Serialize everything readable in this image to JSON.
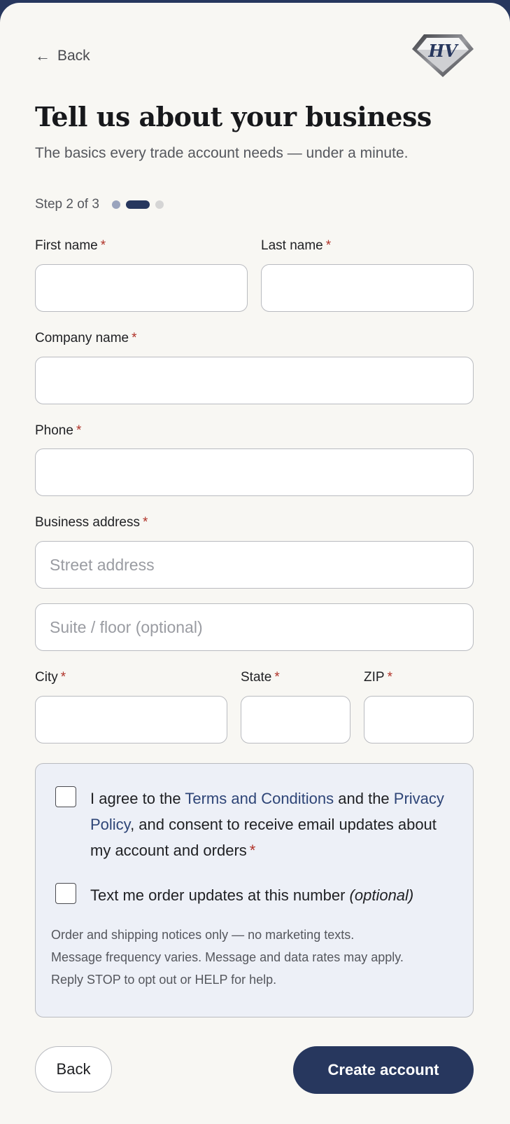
{
  "header": {
    "back_label": "Back",
    "back_arrow": "←",
    "logo_icon": "diamond-monogram-logo",
    "logo_text": "HV"
  },
  "page": {
    "title": "Tell us about your business",
    "subtitle": "The basics every trade account needs — under a minute.",
    "step_label": "Step 2 of 3",
    "step_current": 2,
    "step_total": 3
  },
  "form": {
    "required_marker": "*",
    "first_name": {
      "label": "First name",
      "value": "",
      "placeholder": ""
    },
    "last_name": {
      "label": "Last name",
      "value": "",
      "placeholder": ""
    },
    "company_name": {
      "label": "Company name",
      "value": "",
      "placeholder": ""
    },
    "phone": {
      "label": "Phone",
      "value": "",
      "placeholder": ""
    },
    "business_address": {
      "label": "Business address"
    },
    "street": {
      "value": "",
      "placeholder": "Street address"
    },
    "suite": {
      "value": "",
      "placeholder": "Suite / floor (optional)"
    },
    "city": {
      "label": "City",
      "value": "",
      "placeholder": ""
    },
    "state": {
      "label": "State",
      "value": "",
      "placeholder": ""
    },
    "zip": {
      "label": "ZIP",
      "value": "",
      "placeholder": ""
    }
  },
  "consent": {
    "agree_prefix": "I agree to the ",
    "terms_link": "Terms and Conditions",
    "agree_middle": " and the ",
    "privacy_link": "Privacy Policy",
    "agree_suffix": ", and consent to receive email updates about my account and orders",
    "agree_checked": false,
    "sms_label": "Text me order updates at this number ",
    "sms_optional": "(optional)",
    "sms_checked": false,
    "fine_print_1": "Order and shipping notices only — no marketing texts.",
    "fine_print_2": "Message frequency varies. Message and data rates may apply.",
    "fine_print_3": "Reply STOP to opt out or HELP for help."
  },
  "actions": {
    "back_label": "Back",
    "create_label": "Create account"
  },
  "colors": {
    "brand": "#27375e",
    "required": "#b03228",
    "link": "#2e4577",
    "consent_bg": "#edf0f7"
  }
}
